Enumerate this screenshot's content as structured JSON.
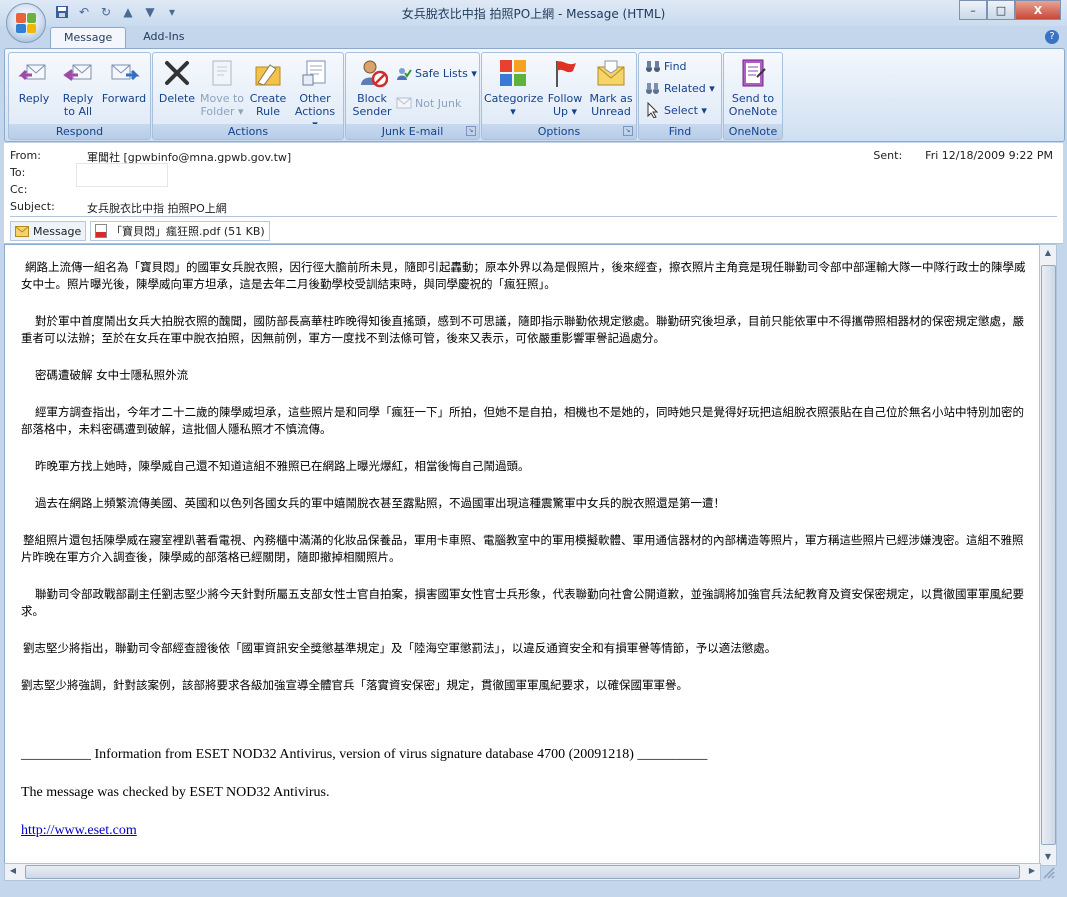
{
  "window": {
    "title": "女兵脫衣比中指 拍照PO上網 - Message (HTML)",
    "min": "–",
    "max": "□",
    "close": "X"
  },
  "tabs": [
    "Message",
    "Add-Ins"
  ],
  "help": "?",
  "ribbon": {
    "respond": {
      "label": "Respond",
      "reply": "Reply",
      "reply_all_1": "Reply",
      "reply_all_2": "to All",
      "forward": "Forward"
    },
    "actions": {
      "label": "Actions",
      "delete": "Delete",
      "move_1": "Move to",
      "move_2": "Folder ▾",
      "rule_1": "Create",
      "rule_2": "Rule",
      "other_1": "Other",
      "other_2": "Actions ▾"
    },
    "junk": {
      "label": "Junk E-mail",
      "block_1": "Block",
      "block_2": "Sender",
      "safe_lists": "Safe Lists ▾",
      "not_junk": "Not Junk"
    },
    "options": {
      "label": "Options",
      "categorize_1": "Categorize",
      "categorize_2": "▾",
      "follow_1": "Follow",
      "follow_2": "Up ▾",
      "mark_1": "Mark as",
      "mark_2": "Unread"
    },
    "find": {
      "label": "Find",
      "find": "Find",
      "related": "Related ▾",
      "select": "Select ▾"
    },
    "onenote": {
      "label": "OneNote",
      "send_1": "Send to",
      "send_2": "OneNote"
    }
  },
  "header": {
    "from_label": "From:",
    "from_value": "軍聞社 [gpwbinfo@mna.gpwb.gov.tw]",
    "to_label": "To:",
    "cc_label": "Cc:",
    "subject_label": "Subject:",
    "subject_value": "女兵脫衣比中指 拍照PO上網",
    "sent_label": "Sent:",
    "sent_value": "Fri 12/18/2009 9:22 PM",
    "attachments": [
      "Message",
      "「寶貝悶」瘋狂照.pdf (51 KB)"
    ]
  },
  "body": {
    "paragraphs": [
      "網路上流傳一組名為「寶貝悶」的國軍女兵脫衣照，因行徑大膽前所未見，隨即引起轟動；原本外界以為是假照片，後來經查，擦衣照片主角竟是現任聯勤司令部中部運輸大隊一中隊行政士的陳學威女中士。照片曝光後，陳學威向軍方坦承，這是去年二月後勤學校受訓結束時，與同學慶祝的「瘋狂照」。",
      "對於軍中首度鬧出女兵大拍脫衣照的醜聞，國防部長高華柱昨晚得知後直搖頭，感到不可思議，隨即指示聯勤依規定懲處。聯勤研究後坦承，目前只能依軍中不得攜帶照相器材的保密規定懲處，嚴重者可以法辦；至於在女兵在軍中脫衣拍照，因無前例，軍方一度找不到法條可管，後來又表示，可依嚴重影響軍譽記過處分。",
      "密碼遭破解 女中士隱私照外流",
      "經軍方調查指出，今年才二十二歲的陳學威坦承，這些照片是和同學「瘋狂一下」所拍，但她不是自拍，相機也不是她的，同時她只是覺得好玩把這組脫衣照張貼在自己位於無名小站中特別加密的部落格中，未料密碼遭到破解，這批個人隱私照才不慎流傳。",
      "昨晚軍方找上她時，陳學威自己還不知道這組不雅照已在網路上曝光爆紅，相當後悔自己鬧過頭。",
      "過去在網路上頻繁流傳美國、英國和以色列各國女兵的軍中嬉鬧脫衣甚至露點照，不過國軍出現這種震驚軍中女兵的脫衣照還是第一遭！",
      "整組照片還包括陳學威在寢室裡趴著看電視、內務櫃中滿滿的化妝品保養品，軍用卡車照、電腦教室中的軍用模擬軟體、軍用通信器材的內部構造等照片，軍方稱這些照片已經涉嫌洩密。這組不雅照片昨晚在軍方介入調查後，陳學威的部落格已經關閉，隨即撤掉相關照片。",
      "聯勤司令部政戰部副主任劉志堅少將今天針對所屬五支部女性士官自拍案，損害國軍女性官士兵形象，代表聯勤向社會公開道歉，並強調將加強官兵法紀教育及資安保密規定，以貫徹國軍軍風紀要求。",
      "劉志堅少將指出，聯勤司令部經查證後依「國軍資訊安全獎懲基準規定」及「陸海空軍懲罰法」，以違反通資安全和有損軍譽等情節，予以適法懲處。",
      "劉志堅少將強調，針對該案例，該部將要求各級加強宣導全體官兵「落實資安保密」規定，貫徹國軍軍風紀要求，以確保國軍軍譽。"
    ],
    "eset_line": "__________ Information from ESET NOD32 Antivirus, version of virus signature database 4700 (20091218) __________",
    "checked_line": "The message was checked by ESET NOD32 Antivirus.",
    "link": "http://www.eset.com"
  },
  "colors": {
    "accent": "#15428b",
    "ribbon_bg": "#dbe7f5",
    "close": "#c8483a"
  }
}
